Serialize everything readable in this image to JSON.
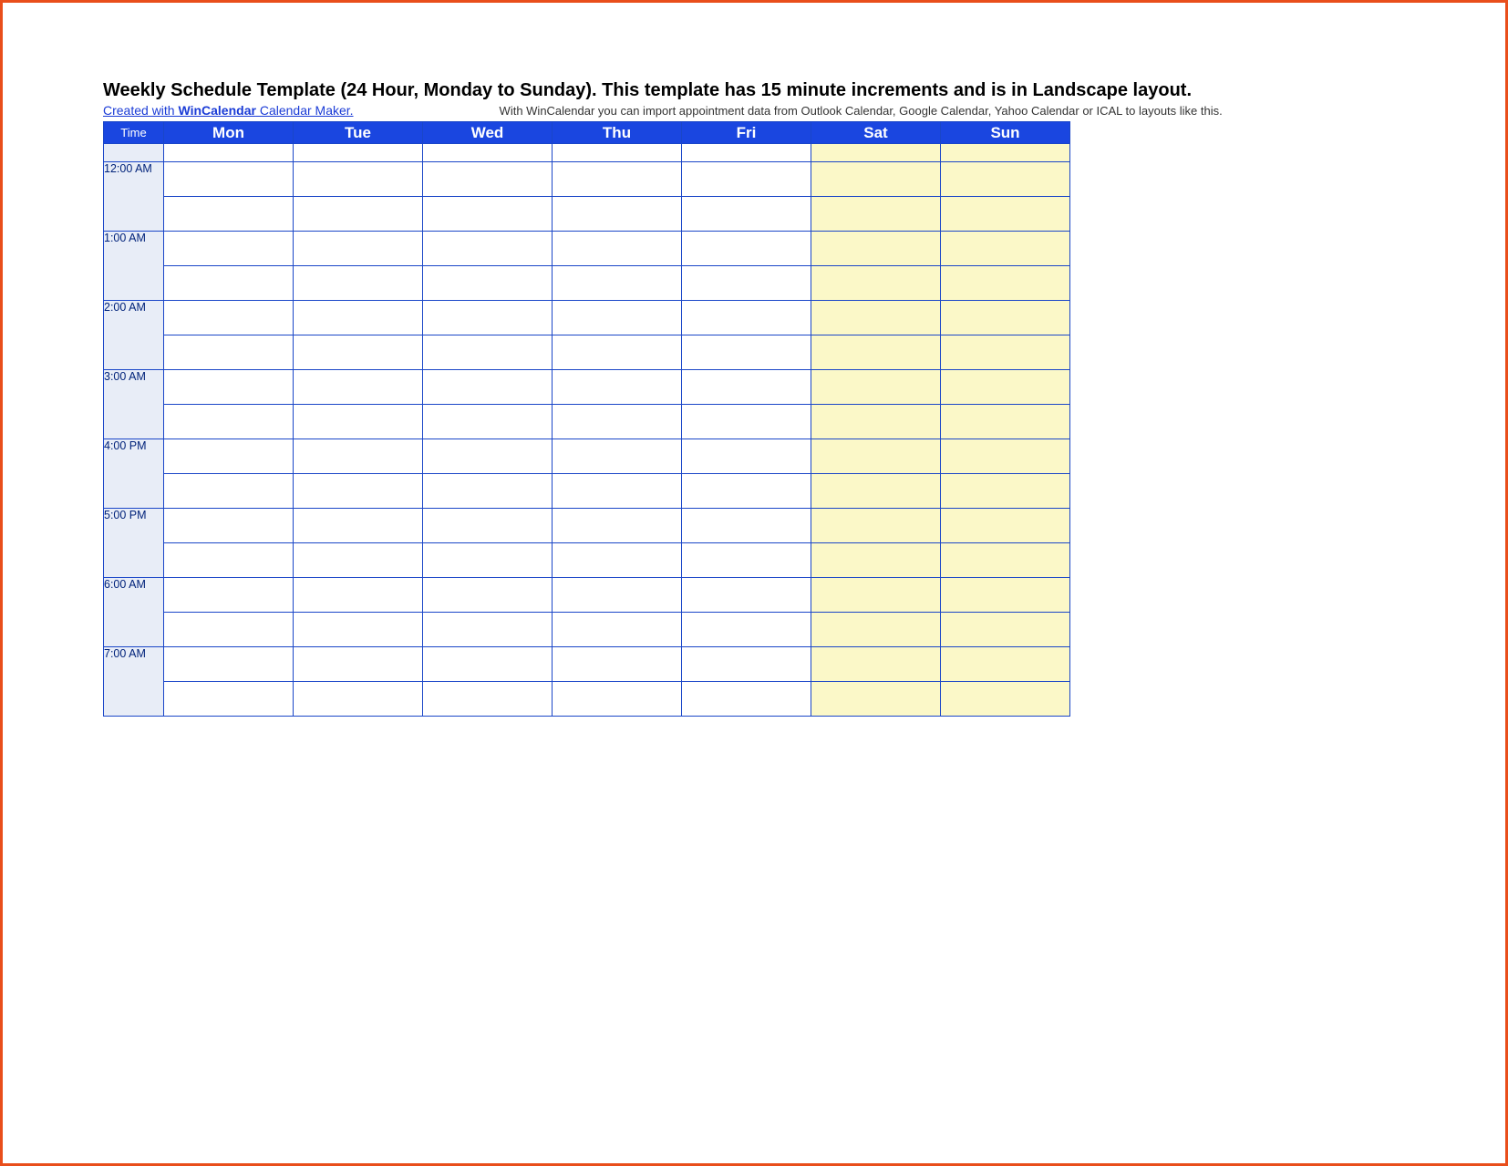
{
  "title": "Weekly Schedule Template (24 Hour, Monday to Sunday).  This template has 15 minute increments and is in Landscape layout.",
  "link_prefix": "Created with ",
  "link_brand": "WinCalendar",
  "link_suffix": " Calendar Maker.",
  "note": "With WinCalendar you can import appointment data from Outlook Calendar, Google Calendar, Yahoo Calendar or ICAL to layouts like this.",
  "columns": {
    "time": "Time",
    "days": [
      "Mon",
      "Tue",
      "Wed",
      "Thu",
      "Fri",
      "Sat",
      "Sun"
    ]
  },
  "weekend_indices": [
    5,
    6
  ],
  "hours": [
    "12:00 AM",
    "1:00 AM",
    "2:00 AM",
    "3:00 AM",
    "4:00 PM",
    "5:00 PM",
    "6:00 AM",
    "7:00 AM"
  ],
  "colors": {
    "frame": "#e94e1b",
    "header_bg": "#1a46e0",
    "grid_border": "#1a46c8",
    "time_col_bg": "#e8edf7",
    "weekend_bg": "#fbf8c8",
    "link": "#1a3bd6"
  }
}
